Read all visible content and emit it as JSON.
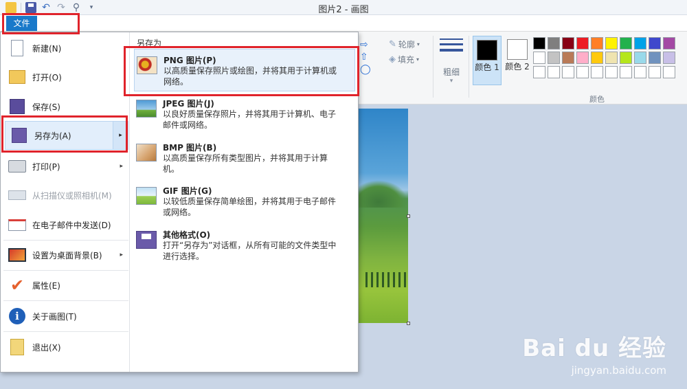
{
  "window": {
    "title": "图片2 - 画图"
  },
  "ribbon": {
    "file_tab": "文件",
    "outline_label": "轮廓",
    "fill_label": "填充",
    "thickness_label": "粗细",
    "color1_label": "颜色 1",
    "color2_label": "颜色 2",
    "colors_group_label": "颜色",
    "color1_value": "#000000",
    "color2_value": "#ffffff",
    "palette": [
      "#000000",
      "#7f7f7f",
      "#880015",
      "#ed1c24",
      "#ff7f27",
      "#fff200",
      "#22b14c",
      "#00a2e8",
      "#3f48cc",
      "#a349a4",
      "#ffffff",
      "#c3c3c3",
      "#b97a57",
      "#ffaec9",
      "#ffc90e",
      "#efe4b0",
      "#b5e61d",
      "#99d9ea",
      "#7092be",
      "#c8bfe7",
      "#ffffff",
      "#ffffff",
      "#ffffff",
      "#ffffff",
      "#ffffff",
      "#ffffff",
      "#ffffff",
      "#ffffff",
      "#ffffff",
      "#ffffff"
    ]
  },
  "file_menu": {
    "items": [
      {
        "label": "新建(N)",
        "icon": "new-document-icon"
      },
      {
        "label": "打开(O)",
        "icon": "open-folder-icon"
      },
      {
        "label": "保存(S)",
        "icon": "save-icon"
      },
      {
        "label": "另存为(A)",
        "icon": "save-as-icon"
      },
      {
        "label": "打印(P)",
        "icon": "printer-icon"
      },
      {
        "label": "从扫描仪或照相机(M)",
        "icon": "scanner-icon"
      },
      {
        "label": "在电子邮件中发送(D)",
        "icon": "email-icon"
      },
      {
        "label": "设置为桌面背景(B)",
        "icon": "desktop-background-icon"
      },
      {
        "label": "属性(E)",
        "icon": "properties-checkmark-icon"
      },
      {
        "label": "关于画图(T)",
        "icon": "info-icon"
      },
      {
        "label": "退出(X)",
        "icon": "exit-icon"
      }
    ]
  },
  "save_as_panel": {
    "heading": "另存为",
    "options": [
      {
        "title": "PNG 图片(P)",
        "desc": "以高质量保存照片或绘图，并将其用于计算机或网络。",
        "icon": "png-image-icon"
      },
      {
        "title": "JPEG 图片(J)",
        "desc": "以良好质量保存照片，并将其用于计算机、电子邮件或网络。",
        "icon": "jpeg-image-icon"
      },
      {
        "title": "BMP 图片(B)",
        "desc": "以高质量保存所有类型图片，并将其用于计算机。",
        "icon": "bmp-image-icon"
      },
      {
        "title": "GIF 图片(G)",
        "desc": "以较低质量保存简单绘图，并将其用于电子邮件或网络。",
        "icon": "gif-image-icon"
      },
      {
        "title": "其他格式(O)",
        "desc": "打开“另存为”对话框，从所有可能的文件类型中进行选择。",
        "icon": "other-formats-icon"
      }
    ]
  },
  "watermark": {
    "brand": "Bai du 经验",
    "url": "jingyan.baidu.com"
  }
}
